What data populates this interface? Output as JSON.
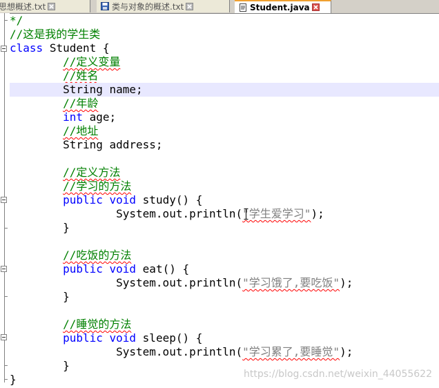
{
  "tabs": [
    {
      "label": "对象思想概述.txt",
      "icon": "text-file-icon",
      "active": false
    },
    {
      "label": "类与对象的概述.txt",
      "icon": "save-icon",
      "active": false
    },
    {
      "label": "Student.java",
      "icon": "document-icon",
      "active": true
    }
  ],
  "code": {
    "comment_end": "*/",
    "class_comment": "//这是我的学生类",
    "class_kw": "class",
    "class_decl": "Student {",
    "c_define_vars": "//定义变量",
    "c_name": "//姓名",
    "name_decl": "String name;",
    "c_age": "//年龄",
    "int_kw": "int",
    "age_rest": "age;",
    "c_address": "//地址",
    "address_decl": "String address;",
    "c_define_methods": "//定义方法",
    "c_study_method": "//学习的方法",
    "public_kw": "public",
    "void_kw": "void",
    "study_sig": "study() {",
    "print_prefix": "System.out.println(",
    "study_str": "\"学生爱学习\"",
    "print_suffix": ");",
    "close_brace": "}",
    "c_eat_method": "//吃饭的方法",
    "eat_sig": "eat() {",
    "eat_str": "\"学习饿了,要吃饭\"",
    "c_sleep_method": "//睡觉的方法",
    "sleep_sig": "sleep() {",
    "sleep_str": "\"学习累了,要睡觉\""
  },
  "watermark": "https://blog.csdn.net/weixin_44055622",
  "colors": {
    "keyword": "#0000ff",
    "comment": "#008000",
    "string": "#808080",
    "current_line": "#e8e8ff",
    "active_tab_accent": "#f0a030"
  }
}
